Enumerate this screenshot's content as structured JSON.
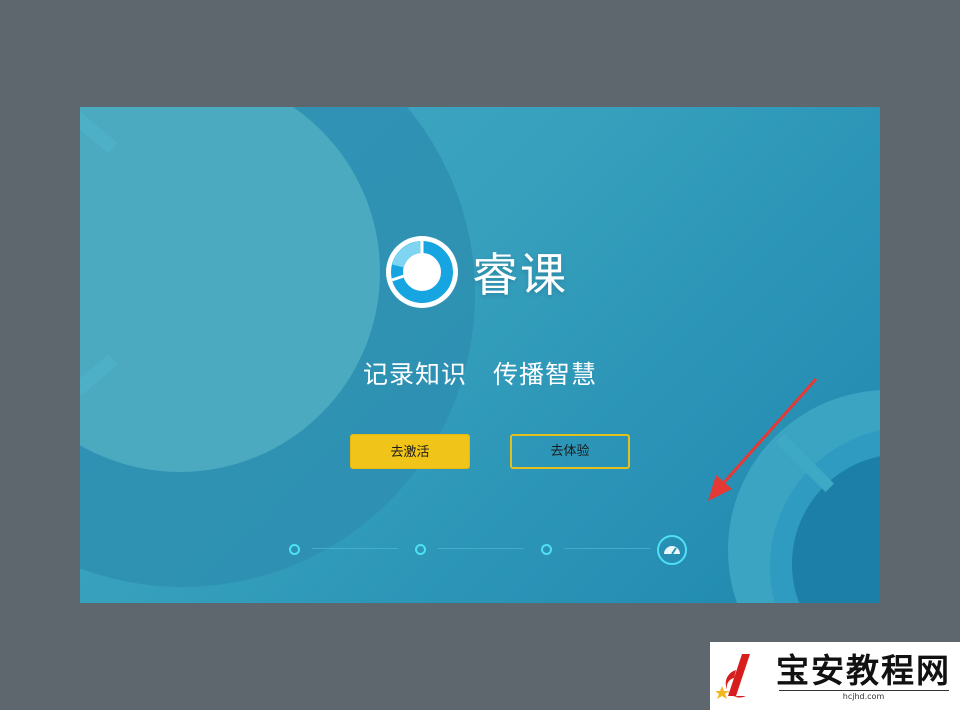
{
  "app": {
    "name": "睿课",
    "slogan_part1": "记录知识",
    "slogan_part2": "传播智慧"
  },
  "buttons": {
    "activate_label": "去激活",
    "trial_label": "去体验"
  },
  "steps": {
    "total": 4,
    "current": 4
  },
  "watermark": {
    "title": "宝安教程网",
    "url": "hcjhd.com"
  },
  "colors": {
    "background": "#5f676e",
    "panel": "#36a0bd",
    "primary_button": "#f0c419",
    "step_accent": "#4fe0f2",
    "arrow": "#e53935"
  }
}
